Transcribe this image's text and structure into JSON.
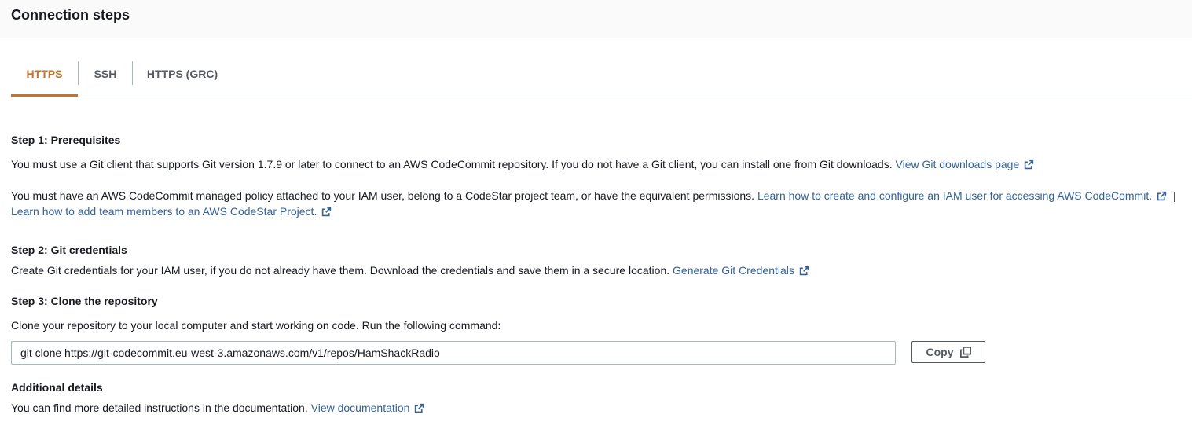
{
  "header": {
    "title": "Connection steps"
  },
  "tabs": [
    {
      "label": "HTTPS"
    },
    {
      "label": "SSH"
    },
    {
      "label": "HTTPS (GRC)"
    }
  ],
  "step1": {
    "title": "Step 1: Prerequisites",
    "para1_text": "You must use a Git client that supports Git version 1.7.9 or later to connect to an AWS CodeCommit repository. If you do not have a Git client, you can install one from Git downloads.",
    "para1_link": "View Git downloads page",
    "para2_text": "You must have an AWS CodeCommit managed policy attached to your IAM user, belong to a CodeStar project team, or have the equivalent permissions.",
    "para2_link1": "Learn how to create and configure an IAM user for accessing AWS CodeCommit.",
    "para2_separator": "|",
    "para2_link2": "Learn how to add team members to an AWS CodeStar Project."
  },
  "step2": {
    "title": "Step 2: Git credentials",
    "text": "Create Git credentials for your IAM user, if you do not already have them. Download the credentials and save them in a secure location.",
    "link": "Generate Git Credentials"
  },
  "step3": {
    "title": "Step 3: Clone the repository",
    "text": "Clone your repository to your local computer and start working on code. Run the following command:",
    "command": "git clone https://git-codecommit.eu-west-3.amazonaws.com/v1/repos/HamShackRadio",
    "copy_label": "Copy"
  },
  "additional": {
    "title": "Additional details",
    "text": "You can find more detailed instructions in the documentation.",
    "link": "View documentation"
  },
  "icons": {
    "external_link": "external-link-icon",
    "copy": "copy-icon"
  },
  "colors": {
    "active_tab": "#c7722b",
    "link": "#33629b",
    "text": "#16191f"
  }
}
